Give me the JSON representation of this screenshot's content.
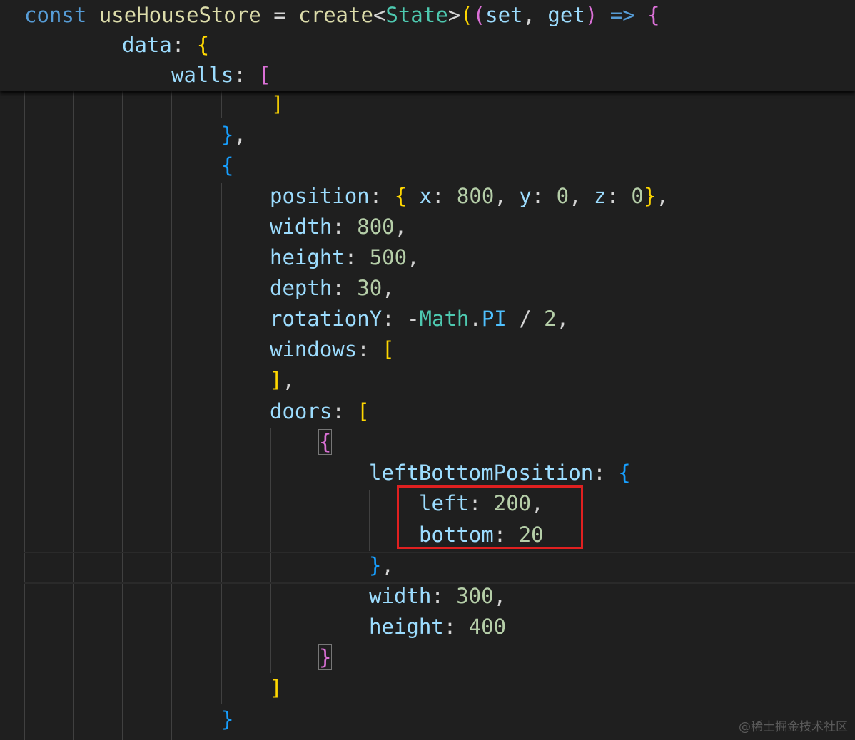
{
  "sticky": {
    "l1": {
      "kw": "const",
      "name": "useHouseStore",
      "eq": " = ",
      "fn": "create",
      "lt": "<",
      "type": "State",
      "gt": ">",
      "p1": "(",
      "p2": "(",
      "a1": "set",
      "comma": ", ",
      "a2": "get",
      "p3": ")",
      "arrow": "=>",
      "brace": "{"
    },
    "l2": {
      "prop": "data",
      "colon": ": ",
      "brace": "{"
    },
    "l3": {
      "prop": "walls",
      "colon": ": ",
      "bracket": "["
    }
  },
  "code": {
    "l1": {
      "bracket": "]"
    },
    "l2": {
      "brace": "}",
      "punct": ","
    },
    "l3": {
      "brace": "{"
    },
    "l4": {
      "prop": "position",
      "colon": ": ",
      "ob": "{",
      "k1": " x",
      "c1": ": ",
      "v1": "800",
      "s1": ", ",
      "k2": "y",
      "c2": ": ",
      "v2": "0",
      "s2": ", ",
      "k3": "z",
      "c3": ": ",
      "v3": "0",
      "cb": "}",
      "end": ","
    },
    "l5": {
      "prop": "width",
      "colon": ": ",
      "val": "800",
      "end": ","
    },
    "l6": {
      "prop": "height",
      "colon": ": ",
      "val": "500",
      "end": ","
    },
    "l7": {
      "prop": "depth",
      "colon": ": ",
      "val": "30",
      "end": ","
    },
    "l8": {
      "prop": "rotationY",
      "colon": ": ",
      "neg": "-",
      "obj": "Math",
      "dot": ".",
      "const": "PI",
      "div": " / ",
      "val": "2",
      "end": ","
    },
    "l9": {
      "prop": "windows",
      "colon": ": ",
      "bracket": "["
    },
    "l10": {
      "bracket": "]",
      "end": ","
    },
    "l11": {
      "prop": "doors",
      "colon": ": ",
      "bracket": "["
    },
    "l12": {
      "brace": "{"
    },
    "l13": {
      "prop": "leftBottomPosition",
      "colon": ": ",
      "brace": "{"
    },
    "l14": {
      "prop": "left",
      "colon": ": ",
      "val": "200",
      "end": ","
    },
    "l15": {
      "prop": "bottom",
      "colon": ": ",
      "val": "20"
    },
    "l16": {
      "brace": "}",
      "end": ","
    },
    "l17": {
      "prop": "width",
      "colon": ": ",
      "val": "300",
      "end": ","
    },
    "l18": {
      "prop": "height",
      "colon": ": ",
      "val": "400"
    },
    "l19": {
      "brace": "}"
    },
    "l20": {
      "bracket": "]"
    },
    "l21": {
      "brace": "}"
    }
  },
  "watermark": "@稀土掘金技术社区",
  "colors": {
    "background": "#1f1f1f",
    "keyword": "#569cd6",
    "property": "#9cdcfe",
    "number": "#b5cea8",
    "function": "#dcdcaa",
    "type": "#4ec9b0",
    "highlight": "#e02020"
  }
}
